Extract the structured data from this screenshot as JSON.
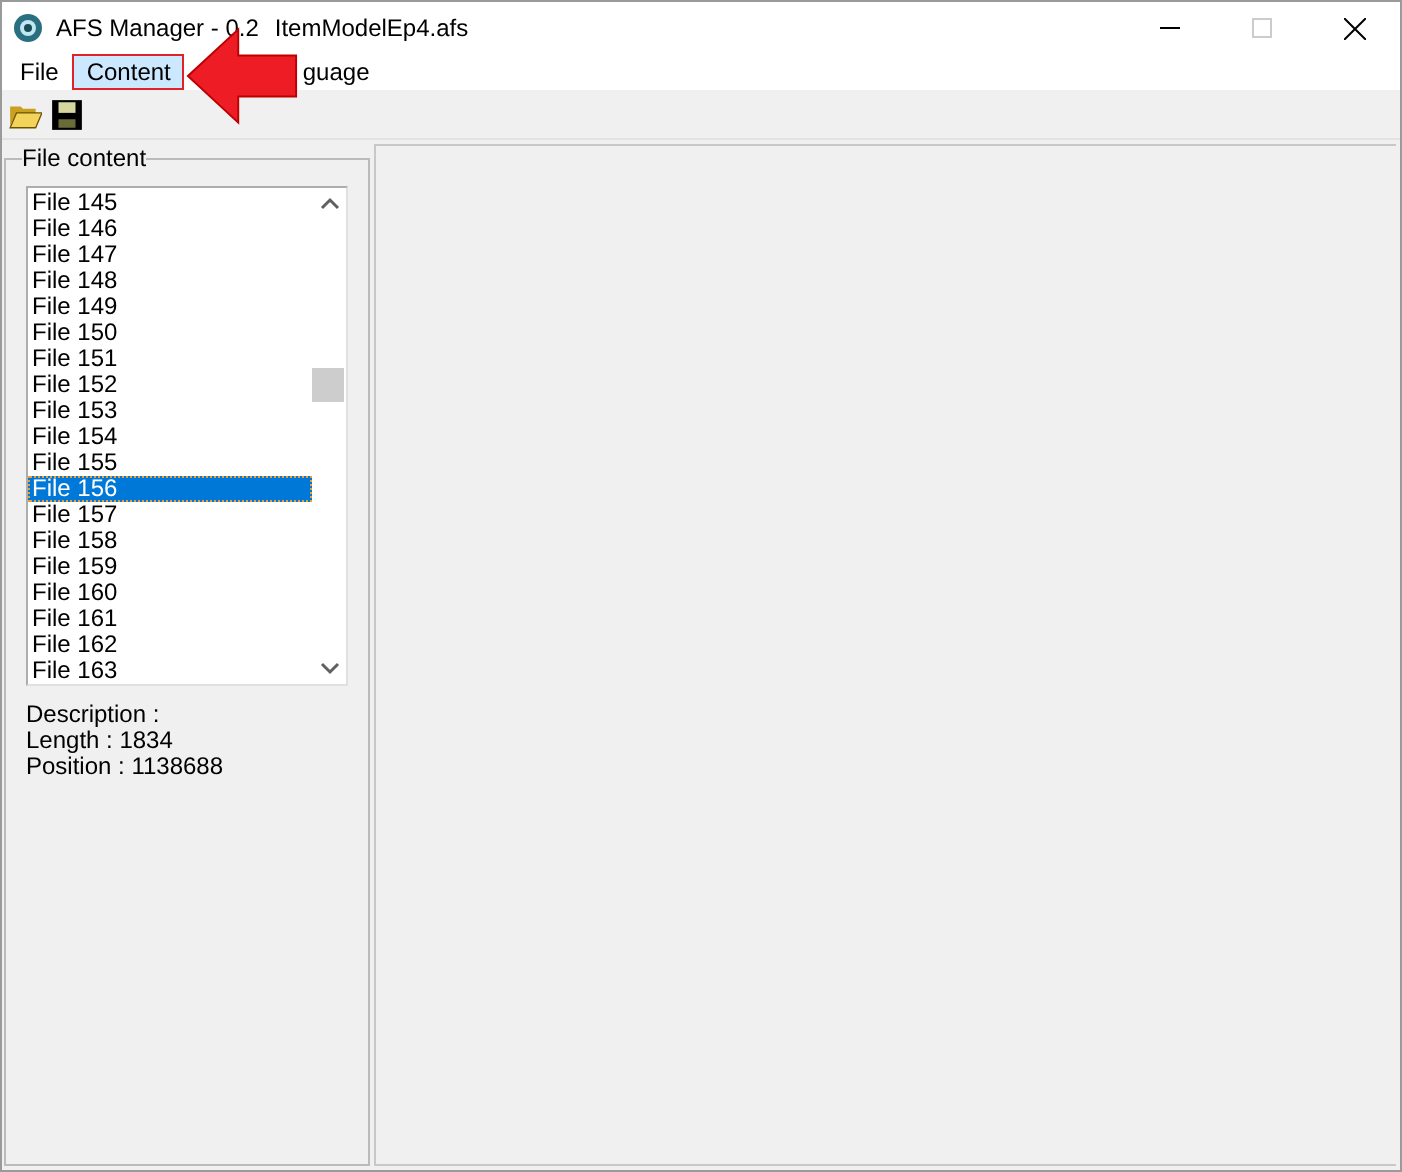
{
  "window": {
    "title_parts": [
      "AFS Manager - 0.2",
      "ItemModelEp4.afs"
    ]
  },
  "menu": [
    {
      "label": "File",
      "selected": false
    },
    {
      "label": "Content",
      "selected": true
    },
    {
      "label": "guage",
      "selected": false
    }
  ],
  "group": {
    "title": "File content",
    "items": [
      {
        "label": "File 145",
        "selected": false
      },
      {
        "label": "File 146",
        "selected": false
      },
      {
        "label": "File 147",
        "selected": false
      },
      {
        "label": "File 148",
        "selected": false
      },
      {
        "label": "File 149",
        "selected": false
      },
      {
        "label": "File 150",
        "selected": false
      },
      {
        "label": "File 151",
        "selected": false
      },
      {
        "label": "File 152",
        "selected": false
      },
      {
        "label": "File 153",
        "selected": false
      },
      {
        "label": "File 154",
        "selected": false
      },
      {
        "label": "File 155",
        "selected": false
      },
      {
        "label": "File 156",
        "selected": true
      },
      {
        "label": "File 157",
        "selected": false
      },
      {
        "label": "File 158",
        "selected": false
      },
      {
        "label": "File 159",
        "selected": false
      },
      {
        "label": "File 160",
        "selected": false
      },
      {
        "label": "File 161",
        "selected": false
      },
      {
        "label": "File 162",
        "selected": false
      },
      {
        "label": "File 163",
        "selected": false
      }
    ],
    "details": [
      "Description :",
      "Length : 1834",
      "Position : 1138688"
    ]
  }
}
